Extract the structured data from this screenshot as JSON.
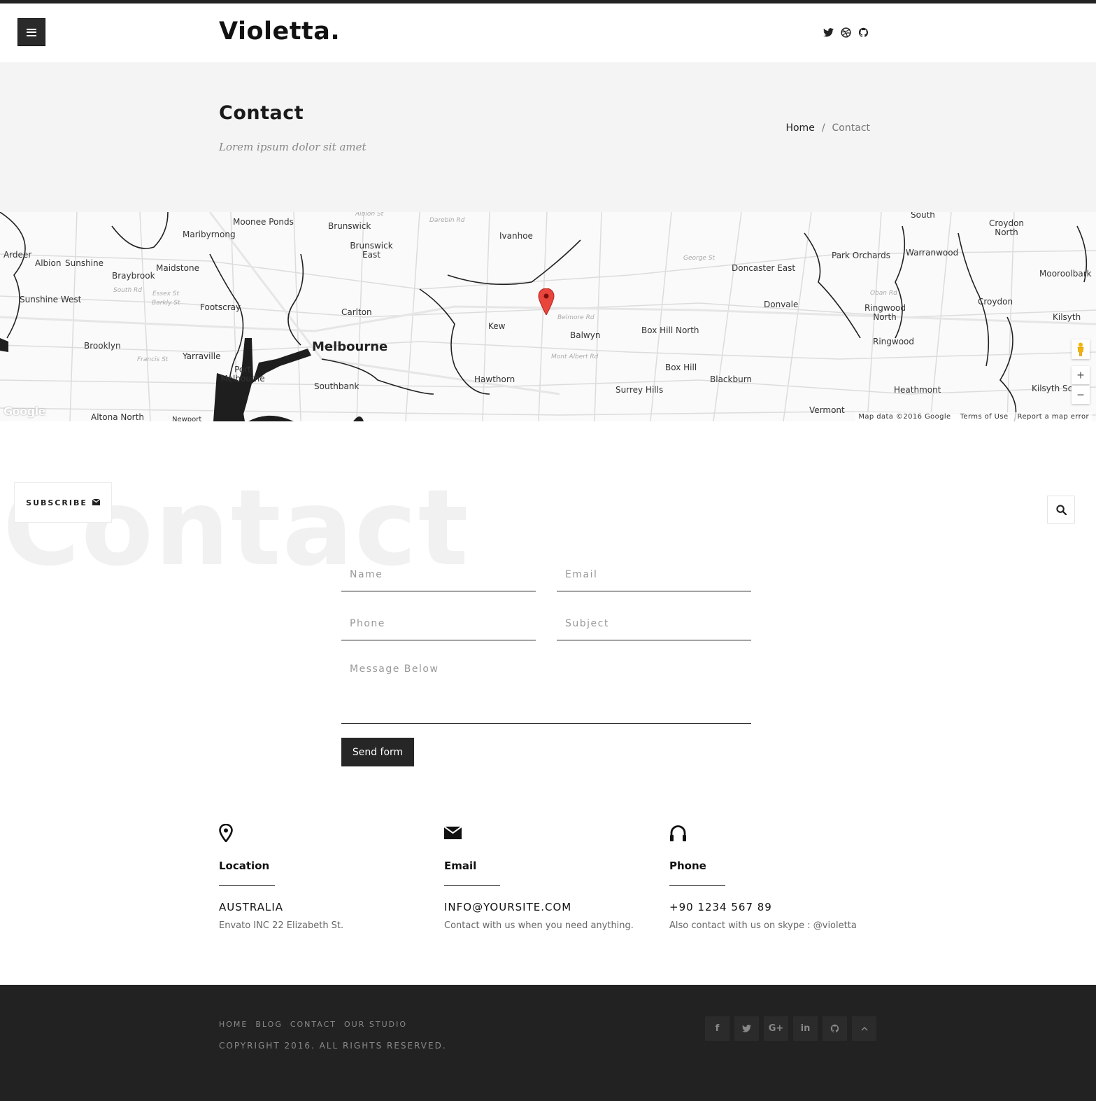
{
  "header": {
    "logo": "Violetta.",
    "social": [
      "twitter-icon",
      "dribbble-icon",
      "github-icon"
    ]
  },
  "title_band": {
    "title": "Contact",
    "subtitle": "Lorem ipsum dolor sit amet",
    "breadcrumb": {
      "home": "Home",
      "separator": "/",
      "current": "Contact"
    }
  },
  "map": {
    "labels": {
      "moonee_ponds": "Moonee Ponds",
      "brunswick": "Brunswick",
      "brunswick_east": "Brunswick East",
      "ivanhoe": "Ivanhoe",
      "maribyrnong": "Maribyrnong",
      "ardeer": "Ardeer",
      "albion": "Albion",
      "sunshine": "Sunshine",
      "maidstone": "Maidstone",
      "braybrook": "Braybrook",
      "sunshine_west": "Sunshine West",
      "footscray": "Footscray",
      "carlton": "Carlton",
      "kew": "Kew",
      "balwyn": "Balwyn",
      "box_hill_north": "Box Hill North",
      "doncaster_east": "Doncaster East",
      "donvale": "Donvale",
      "park_orchards": "Park Orchards",
      "warranwood": "Warranwood",
      "croydon_north": "Croydon North",
      "mooroolbark": "Mooroolbark",
      "ringwood_north": "Ringwood North",
      "croydon": "Croydon",
      "kilsyth": "Kilsyth",
      "ringwood": "Ringwood",
      "melbourne": "Melbourne",
      "brooklyn": "Brooklyn",
      "yarraville": "Yarraville",
      "port_melbourne": "Port Melbourne",
      "southbank": "Southbank",
      "hawthorn": "Hawthorn",
      "box_hill": "Box Hill",
      "blackburn": "Blackburn",
      "surrey_hills": "Surrey Hills",
      "heathmont": "Heathmont",
      "kilsyth_south": "Kilsyth Sc",
      "vermont": "Vermont",
      "altona_north": "Altona North",
      "newport": "Newport",
      "south": "South",
      "belmore_rd": "Belmore Rd",
      "mont_albert_rd": "Mont Albert Rd",
      "george_st": "George St",
      "south_rd": "South Rd",
      "francis_st": "Francis St",
      "oban_rd": "Oban Rd",
      "darebin_rd": "Darebin Rd",
      "albion_st": "Albion St",
      "essex_st": "Essex St",
      "barkly_st": "Barkly St"
    },
    "footer": {
      "data": "Map data ©2016 Google",
      "terms": "Terms of Use",
      "report": "Report a map error"
    },
    "google_logo": "Google",
    "zoom_in": "+",
    "zoom_out": "−",
    "pin_color": "#e8453c"
  },
  "contact": {
    "background_word": "Contact",
    "subscribe_label": "SUBSCRIBE",
    "form": {
      "name_placeholder": "Name",
      "email_placeholder": "Email",
      "phone_placeholder": "Phone",
      "subject_placeholder": "Subject",
      "message_placeholder": "Message Below",
      "send_label": "Send form"
    }
  },
  "info": [
    {
      "icon": "location-pin-icon",
      "title": "Location",
      "value": "AUSTRALIA",
      "desc": "Envato INC 22 Elizabeth St."
    },
    {
      "icon": "envelope-icon",
      "title": "Email",
      "value": "INFO@YOURSITE.COM",
      "desc": "Contact with us when you need anything."
    },
    {
      "icon": "headphones-icon",
      "title": "Phone",
      "value": "+90 1234 567 89",
      "desc": "Also contact with us on skype : @violetta"
    }
  ],
  "footer": {
    "nav": [
      "HOME",
      "BLOG",
      "CONTACT",
      "OUR STUDIO"
    ],
    "copyright": "COPYRIGHT 2016. ALL RIGHTS RESERVED.",
    "social": [
      {
        "icon": "facebook-icon",
        "glyph": "f"
      },
      {
        "icon": "twitter-icon",
        "glyph": ""
      },
      {
        "icon": "google-plus-icon",
        "glyph": "G+"
      },
      {
        "icon": "linkedin-icon",
        "glyph": "in"
      },
      {
        "icon": "github-icon",
        "glyph": ""
      },
      {
        "icon": "back-to-top-icon",
        "glyph": ""
      }
    ]
  }
}
